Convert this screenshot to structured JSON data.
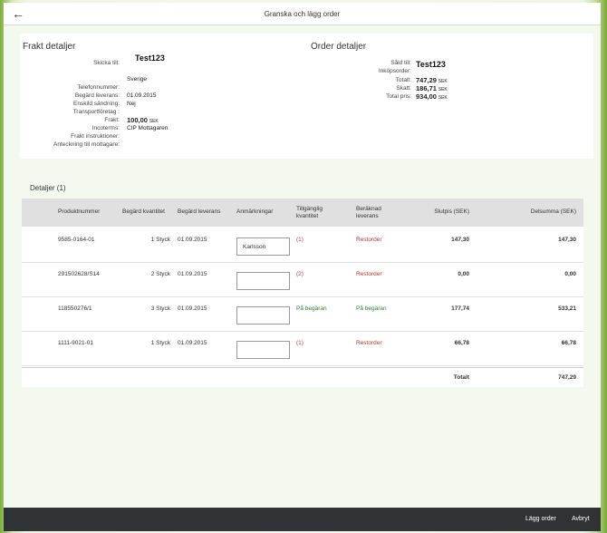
{
  "header": {
    "title": "Granska och lägg order",
    "back_icon": "←"
  },
  "shipping": {
    "title": "Frakt detaljer",
    "fields": [
      {
        "label": "Skicka till:",
        "value": "Test123"
      },
      {
        "label": "",
        "value": "Sverige"
      },
      {
        "label": "Telefonnummer:",
        "value": ""
      },
      {
        "label": "Begärd leverans:",
        "value": "01.09.2015"
      },
      {
        "label": "Enskild sändning:",
        "value": "Nej"
      },
      {
        "label": "Transportföretag :",
        "value": ""
      },
      {
        "label": "Frakt:",
        "value": "100,00",
        "unit": "SEK"
      },
      {
        "label": "Incoterms:",
        "value": "CIP Mottagaren"
      },
      {
        "label": "Frakt instruktioner:",
        "value": ""
      },
      {
        "label": "Anteckning till mottagare:",
        "value": ""
      }
    ]
  },
  "order": {
    "title": "Order detaljer",
    "fields": [
      {
        "label": "Såld till:",
        "value": "Test123"
      },
      {
        "label": "Inköpsorder:",
        "value": ""
      },
      {
        "label": "Totalt:",
        "value": "747,29",
        "unit": "SEK"
      },
      {
        "label": "Skatt:",
        "value": "186,71",
        "unit": "SEK"
      },
      {
        "label": "Total pris:",
        "value": "934,00",
        "unit": "SEK"
      }
    ]
  },
  "details": {
    "heading": "Detaljer (1)",
    "columns": [
      "Produktnummer",
      "Begärd kvantitet",
      "Begärd leverans",
      "Anmärkningar",
      "Tillgänglig kvantitet",
      "Beräknad leverans",
      "Slutpis (SEK)",
      "Delsumma (SEK)"
    ],
    "rows": [
      {
        "product": "9585-0164-01",
        "qty": "1 Styck",
        "delivery": "01.09.2015",
        "remark": "Karlsson",
        "available": "(1)",
        "estimated": "Restorder",
        "price": "147,30",
        "subtotal": "147,30",
        "status": "red"
      },
      {
        "product": "291502628/S14",
        "qty": "2 Styck",
        "delivery": "01.09.2015",
        "remark": "",
        "available": "(2)",
        "estimated": "Restorder",
        "price": "0,00",
        "subtotal": "0,00",
        "status": "red"
      },
      {
        "product": "118550276/1",
        "qty": "3 Styck",
        "delivery": "01.09.2015",
        "remark": "",
        "available": "På begäran",
        "estimated": "På begäran",
        "price": "177,74",
        "subtotal": "533,21",
        "status": "green"
      },
      {
        "product": "1111-9021-01",
        "qty": "1 Styck",
        "delivery": "01.09.2015",
        "remark": "",
        "available": "(1)",
        "estimated": "Restorder",
        "price": "66,78",
        "subtotal": "66,78",
        "status": "red"
      }
    ],
    "total_label": "Totalt",
    "total_value": "747,29"
  },
  "footer": {
    "place_order": "Lägg order",
    "cancel": "Avbryt"
  },
  "colors": {
    "red": "#c0392b",
    "green": "#2e7d32",
    "footer_bg": "#2f3335"
  }
}
